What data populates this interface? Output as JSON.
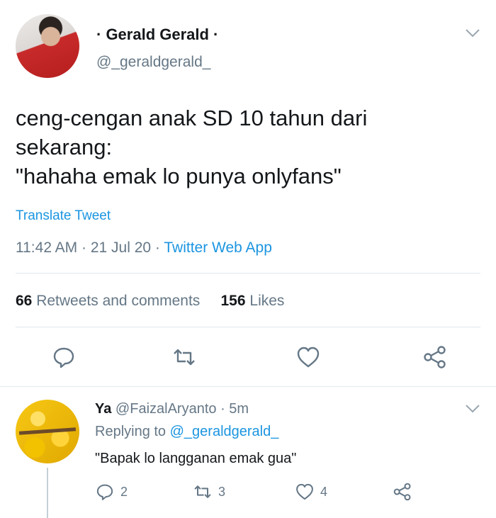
{
  "tweet": {
    "display_name": "· Gerald Gerald ·",
    "handle": "@_geraldgerald_",
    "text_lines": [
      "ceng-cengan anak SD 10 tahun dari",
      "sekarang:",
      "\"hahaha emak lo punya onlyfans\""
    ],
    "translate_label": "Translate Tweet",
    "time": "11:42 AM",
    "date": "21 Jul 20",
    "source": "Twitter Web App",
    "retweets_count": "66",
    "retweets_label": "Retweets and comments",
    "likes_count": "156",
    "likes_label": "Likes",
    "colors": {
      "accent": "#1b95e0",
      "text": "#14171a",
      "muted": "#657786",
      "divider": "#e1e8ed"
    },
    "icons": [
      "reply-icon",
      "retweet-icon",
      "like-icon",
      "share-icon",
      "chevron-down-icon"
    ]
  },
  "reply": {
    "name": "Ya",
    "handle": "@FaizalAryanto",
    "time": "5m",
    "replying_prefix": "Replying to",
    "replying_to": "@_geraldgerald_",
    "text": "\"Bapak lo langganan emak gua\"",
    "reply_count": "2",
    "retweet_count": "3",
    "like_count": "4"
  }
}
